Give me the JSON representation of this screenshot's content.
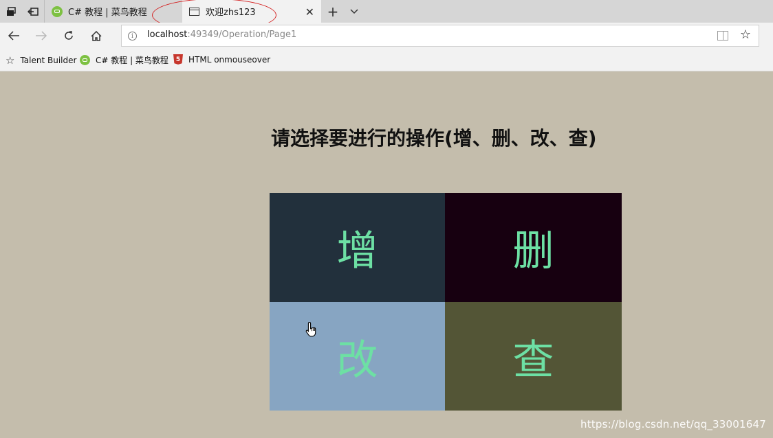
{
  "browser": {
    "tabs": [
      {
        "title": "C# 教程 | 菜鸟教程",
        "active": false
      },
      {
        "title": "欢迎zhs123",
        "active": true
      }
    ],
    "url_host": "localhost",
    "url_rest": ":49349/Operation/Page1",
    "favorites": [
      {
        "label": "Talent Builder",
        "icon": "star-icon"
      },
      {
        "label": "C# 教程 | 菜鸟教程",
        "icon": "runoob-icon"
      },
      {
        "label": "HTML onmouseover",
        "icon": "html5-icon"
      }
    ]
  },
  "page": {
    "heading": "请选择要进行的操作(增、删、改、查)",
    "operations": [
      {
        "label": "增",
        "bg": "#22303c",
        "fg": "#6de0a4"
      },
      {
        "label": "删",
        "bg": "#170010",
        "fg": "#6de0a4"
      },
      {
        "label": "改",
        "bg": "#87a5c2",
        "fg": "#6de0a4"
      },
      {
        "label": "查",
        "bg": "#535536",
        "fg": "#6de0a4"
      }
    ]
  },
  "watermark": "https://blog.csdn.net/qq_33001647",
  "annotation_color": "#d42020"
}
